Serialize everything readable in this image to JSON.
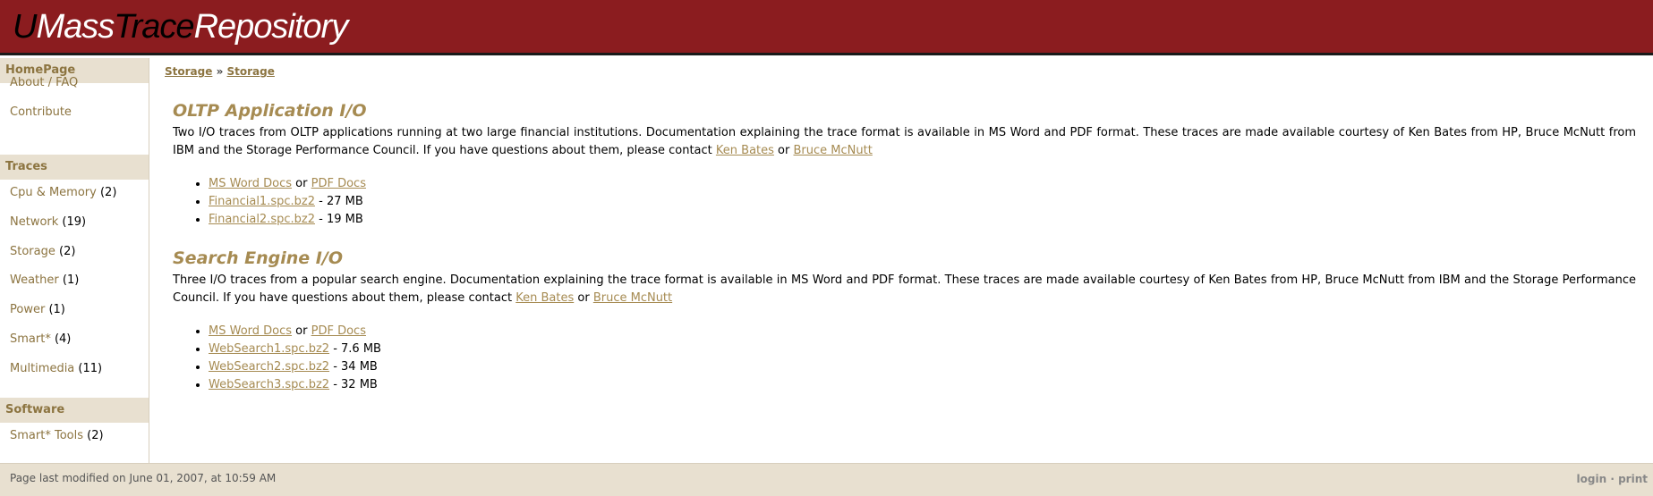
{
  "header": {
    "logo_parts": [
      "U",
      "Mass",
      "Trace",
      "Repository"
    ]
  },
  "sidebar": {
    "sections": [
      {
        "title": "HomePage",
        "items": [
          {
            "label": "About / FAQ",
            "count": ""
          },
          {
            "label": "Contribute",
            "count": ""
          }
        ]
      },
      {
        "title": "Traces",
        "items": [
          {
            "label": "Cpu & Memory",
            "count": "(2)"
          },
          {
            "label": "Network",
            "count": "(19)"
          },
          {
            "label": "Storage",
            "count": "(2)"
          },
          {
            "label": "Weather",
            "count": "(1)"
          },
          {
            "label": "Power",
            "count": "(1)"
          },
          {
            "label": "Smart*",
            "count": "(4)"
          },
          {
            "label": "Multimedia",
            "count": "(11)"
          }
        ]
      },
      {
        "title": "Software",
        "items": [
          {
            "label": "Smart* Tools",
            "count": "(2)"
          }
        ]
      }
    ]
  },
  "breadcrumb": {
    "first": "Storage",
    "separator": "»",
    "second": "Storage"
  },
  "sections": [
    {
      "title": "OLTP Application I/O",
      "description": "Two I/O traces from OLTP applications running at two large financial institutions. Documentation explaining the trace format is available in MS Word and PDF format. These traces are made available courtesy of Ken Bates from HP, Bruce McNutt from IBM and the Storage Performance Council. If you have questions about them, please contact",
      "contact_1": "Ken Bates",
      "contact_or": "or",
      "contact_2": "Bruce McNutt",
      "docs": {
        "word": "MS Word Docs",
        "or": "or",
        "pdf": "PDF Docs"
      },
      "files": [
        {
          "name": "Financial1.spc.bz2",
          "size": "- 27 MB"
        },
        {
          "name": "Financial2.spc.bz2",
          "size": "- 19 MB"
        }
      ]
    },
    {
      "title": "Search Engine I/O",
      "description": "Three I/O traces from a popular search engine. Documentation explaining the trace format is available in MS Word and PDF format. These traces are made available courtesy of Ken Bates from HP, Bruce McNutt from IBM and the Storage Performance Council. If you have questions about them, please contact",
      "contact_1": "Ken Bates",
      "contact_or": "or",
      "contact_2": "Bruce McNutt",
      "docs": {
        "word": "MS Word Docs",
        "or": "or",
        "pdf": "PDF Docs"
      },
      "files": [
        {
          "name": "WebSearch1.spc.bz2",
          "size": "- 7.6 MB"
        },
        {
          "name": "WebSearch2.spc.bz2",
          "size": "- 34 MB"
        },
        {
          "name": "WebSearch3.spc.bz2",
          "size": "- 32 MB"
        }
      ]
    }
  ],
  "footer": {
    "modified": "Page last modified on June 01, 2007, at 10:59 AM",
    "login": "login",
    "dot": "·",
    "print": "print"
  },
  "colors": {
    "header_bg": "#8b1c1f",
    "accent": "#a68b52",
    "panel_bg": "#e8e0d0"
  }
}
